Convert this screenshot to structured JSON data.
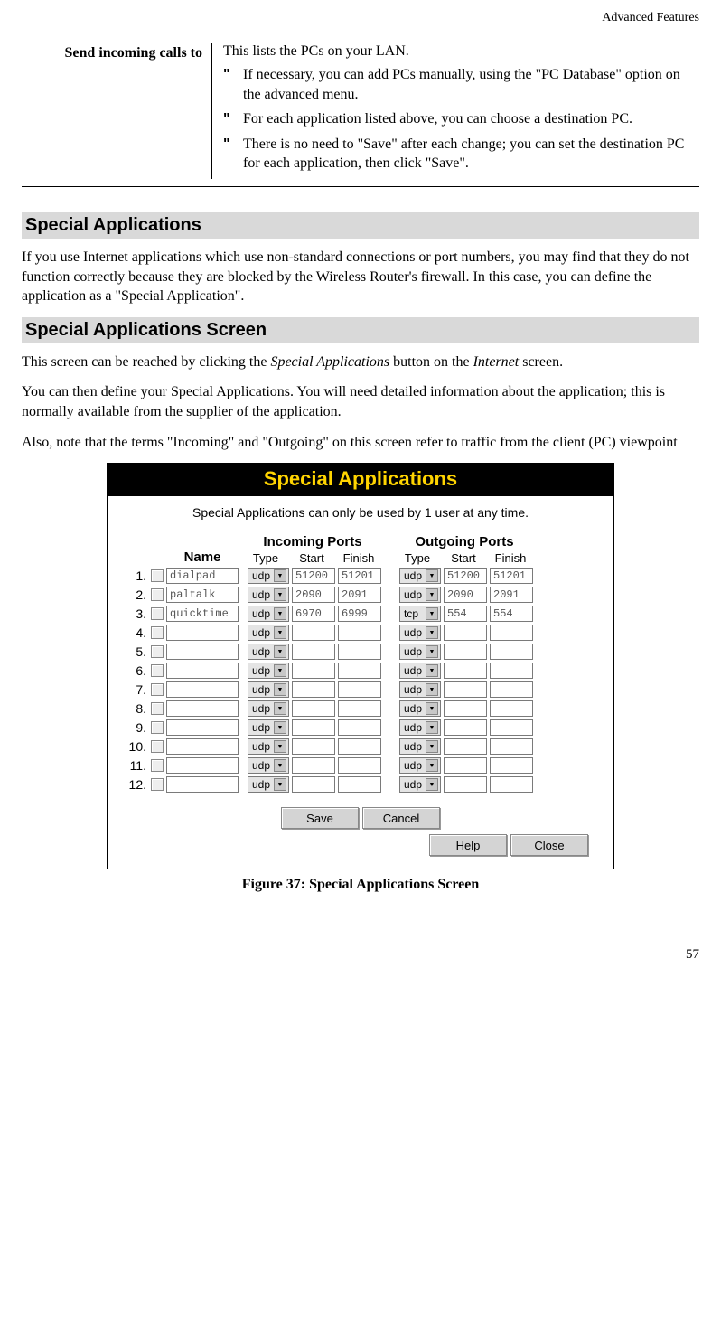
{
  "running_head": "Advanced Features",
  "definition": {
    "term": "Send incoming calls to",
    "intro": "This lists the PCs on your LAN.",
    "bullets": [
      "If necessary, you can add PCs manually, using the \"PC Database\" option on the advanced menu.",
      "For each application listed above, you can choose a destination PC.",
      "There is no need to \"Save\" after each change; you can set the destination PC for each application, then click \"Save\"."
    ]
  },
  "section1": {
    "heading": "Special Applications",
    "para": "If you use Internet applications which use non-standard connections or port numbers, you may find that they do not function correctly because they are blocked by the Wireless Router's firewall. In this case, you can define the application as a \"Special Application\"."
  },
  "section2": {
    "heading": "Special Applications Screen",
    "para1_a": "This screen can be reached by clicking the ",
    "para1_i1": "Special Applications",
    "para1_b": " button on the ",
    "para1_i2": "Internet",
    "para1_c": " screen.",
    "para2": "You can then define your Special Applications. You will need detailed information about the application; this is normally available from the supplier of the application.",
    "para3": "Also, note that the terms \"Incoming\" and \"Outgoing\" on this screen refer to traffic from the client (PC) viewpoint"
  },
  "figure": {
    "title": "Special Applications",
    "note": "Special Applications can only be used by 1 user at any time.",
    "headers": {
      "name": "Name",
      "incoming": "Incoming Ports",
      "outgoing": "Outgoing Ports",
      "type": "Type",
      "start": "Start",
      "finish": "Finish"
    },
    "rows": [
      {
        "num": "1.",
        "name": "dialpad",
        "in_type": "udp",
        "in_start": "51200",
        "in_finish": "51201",
        "out_type": "udp",
        "out_start": "51200",
        "out_finish": "51201"
      },
      {
        "num": "2.",
        "name": "paltalk",
        "in_type": "udp",
        "in_start": "2090",
        "in_finish": "2091",
        "out_type": "udp",
        "out_start": "2090",
        "out_finish": "2091"
      },
      {
        "num": "3.",
        "name": "quicktime",
        "in_type": "udp",
        "in_start": "6970",
        "in_finish": "6999",
        "out_type": "tcp",
        "out_start": "554",
        "out_finish": "554"
      },
      {
        "num": "4.",
        "name": "",
        "in_type": "udp",
        "in_start": "",
        "in_finish": "",
        "out_type": "udp",
        "out_start": "",
        "out_finish": ""
      },
      {
        "num": "5.",
        "name": "",
        "in_type": "udp",
        "in_start": "",
        "in_finish": "",
        "out_type": "udp",
        "out_start": "",
        "out_finish": ""
      },
      {
        "num": "6.",
        "name": "",
        "in_type": "udp",
        "in_start": "",
        "in_finish": "",
        "out_type": "udp",
        "out_start": "",
        "out_finish": ""
      },
      {
        "num": "7.",
        "name": "",
        "in_type": "udp",
        "in_start": "",
        "in_finish": "",
        "out_type": "udp",
        "out_start": "",
        "out_finish": ""
      },
      {
        "num": "8.",
        "name": "",
        "in_type": "udp",
        "in_start": "",
        "in_finish": "",
        "out_type": "udp",
        "out_start": "",
        "out_finish": ""
      },
      {
        "num": "9.",
        "name": "",
        "in_type": "udp",
        "in_start": "",
        "in_finish": "",
        "out_type": "udp",
        "out_start": "",
        "out_finish": ""
      },
      {
        "num": "10.",
        "name": "",
        "in_type": "udp",
        "in_start": "",
        "in_finish": "",
        "out_type": "udp",
        "out_start": "",
        "out_finish": ""
      },
      {
        "num": "11.",
        "name": "",
        "in_type": "udp",
        "in_start": "",
        "in_finish": "",
        "out_type": "udp",
        "out_start": "",
        "out_finish": ""
      },
      {
        "num": "12.",
        "name": "",
        "in_type": "udp",
        "in_start": "",
        "in_finish": "",
        "out_type": "udp",
        "out_start": "",
        "out_finish": ""
      }
    ],
    "buttons": {
      "save": "Save",
      "cancel": "Cancel",
      "help": "Help",
      "close": "Close"
    }
  },
  "caption": "Figure 37: Special Applications Screen",
  "page_number": "57"
}
